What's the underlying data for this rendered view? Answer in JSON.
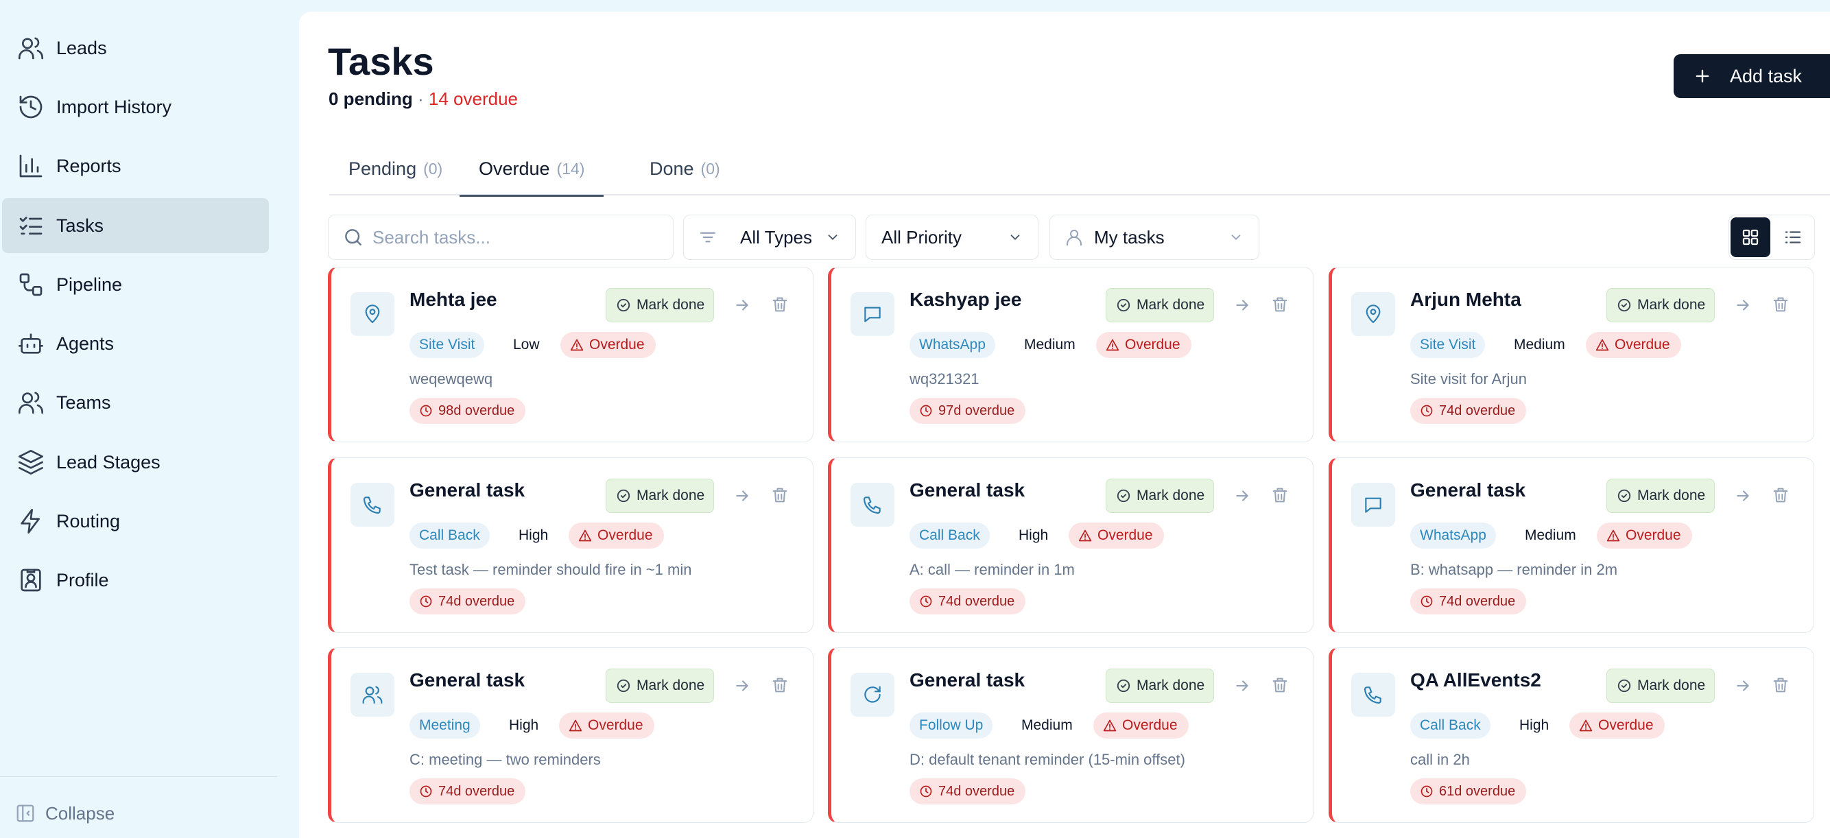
{
  "sidebar": {
    "items": [
      {
        "label": "Leads",
        "icon": "users-icon"
      },
      {
        "label": "Import History",
        "icon": "history-icon"
      },
      {
        "label": "Reports",
        "icon": "bar-chart-icon"
      },
      {
        "label": "Tasks",
        "icon": "list-checks-icon",
        "active": true
      },
      {
        "label": "Pipeline",
        "icon": "pipeline-icon"
      },
      {
        "label": "Agents",
        "icon": "bot-icon"
      },
      {
        "label": "Teams",
        "icon": "team-icon"
      },
      {
        "label": "Lead Stages",
        "icon": "layers-icon"
      },
      {
        "label": "Routing",
        "icon": "zap-icon"
      },
      {
        "label": "Profile",
        "icon": "profile-icon"
      }
    ],
    "collapse_label": "Collapse"
  },
  "header": {
    "title": "Tasks",
    "pending_text": "0 pending",
    "separator": " · ",
    "overdue_text": "14 overdue",
    "add_label": "Add task"
  },
  "tabs": [
    {
      "label": "Pending",
      "count": "(0)"
    },
    {
      "label": "Overdue",
      "count": "(14)",
      "active": true
    },
    {
      "label": "Done",
      "count": "(0)"
    }
  ],
  "filters": {
    "search_placeholder": "Search tasks...",
    "type_value": "All Types",
    "priority_value": "All Priority",
    "owner_value": "My tasks"
  },
  "card_labels": {
    "mark_done": "Mark done",
    "overdue_badge": "Overdue"
  },
  "cards": [
    {
      "title": "Mehta jee",
      "type": "Site Visit",
      "type_icon": "map-pin-icon",
      "priority": "Low",
      "desc": "weqewqewq",
      "ago": "98d overdue"
    },
    {
      "title": "Kashyap jee",
      "type": "WhatsApp",
      "type_icon": "message-icon",
      "priority": "Medium",
      "desc": "wq321321",
      "ago": "97d overdue"
    },
    {
      "title": "Arjun Mehta",
      "type": "Site Visit",
      "type_icon": "map-pin-icon",
      "priority": "Medium",
      "desc": "Site visit for Arjun",
      "ago": "74d overdue"
    },
    {
      "title": "General task",
      "type": "Call Back",
      "type_icon": "phone-icon",
      "priority": "High",
      "desc": "Test task — reminder should fire in ~1 min",
      "ago": "74d overdue"
    },
    {
      "title": "General task",
      "type": "Call Back",
      "type_icon": "phone-icon",
      "priority": "High",
      "desc": "A: call — reminder in 1m",
      "ago": "74d overdue"
    },
    {
      "title": "General task",
      "type": "WhatsApp",
      "type_icon": "message-icon",
      "priority": "Medium",
      "desc": "B: whatsapp — reminder in 2m",
      "ago": "74d overdue"
    },
    {
      "title": "General task",
      "type": "Meeting",
      "type_icon": "meeting-icon",
      "priority": "High",
      "desc": "C: meeting — two reminders",
      "ago": "74d overdue"
    },
    {
      "title": "General task",
      "type": "Follow Up",
      "type_icon": "refresh-icon",
      "priority": "Medium",
      "desc": "D: default tenant reminder (15-min offset)",
      "ago": "74d overdue"
    },
    {
      "title": "QA AllEvents2",
      "type": "Call Back",
      "type_icon": "phone-icon",
      "priority": "High",
      "desc": "call in 2h",
      "ago": "61d overdue"
    }
  ]
}
